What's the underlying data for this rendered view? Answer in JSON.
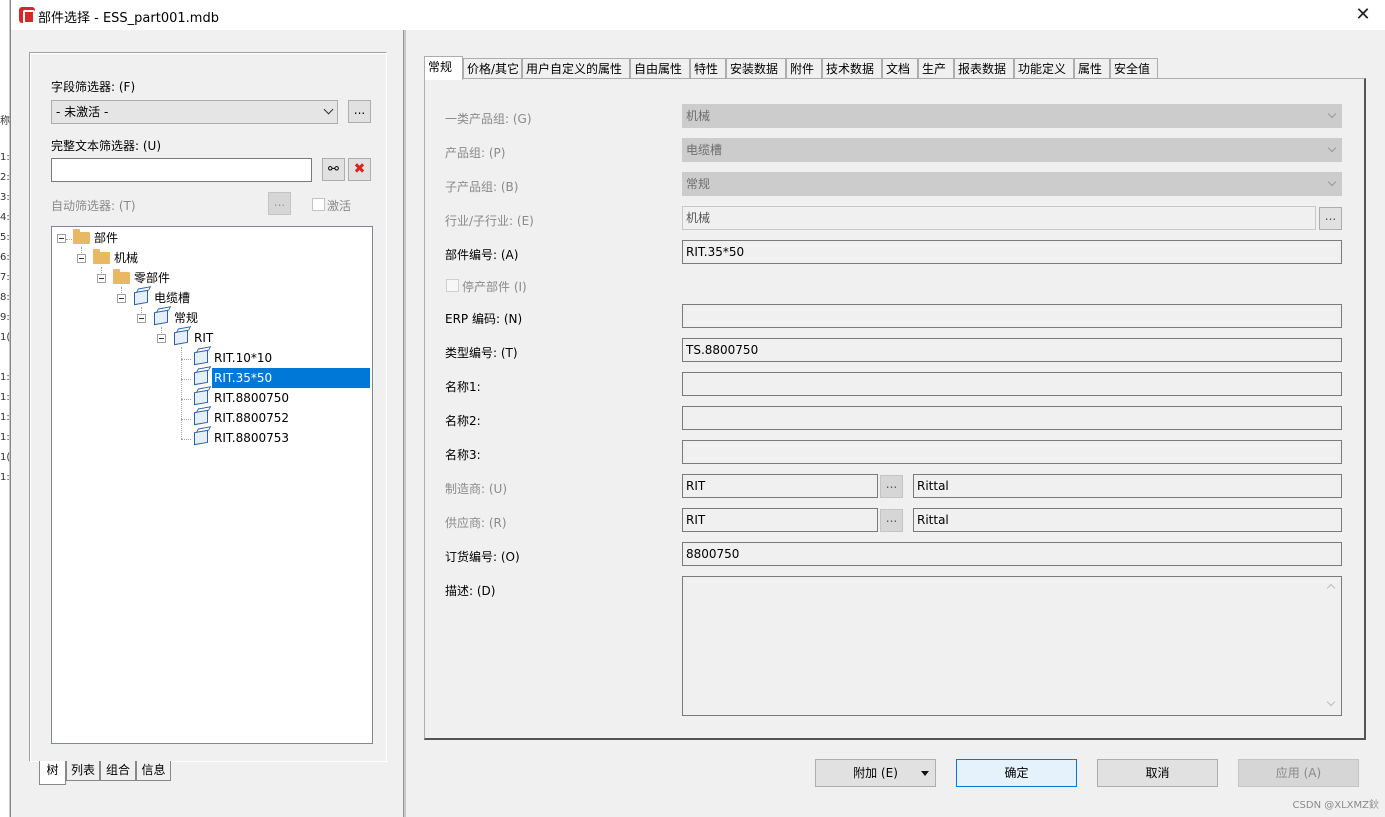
{
  "window": {
    "title": "部件选择 - ESS_part001.mdb"
  },
  "backdrop": {
    "rows": [
      "称",
      "1:",
      "2:",
      "3:",
      "4:",
      "5:",
      "6:",
      "7:",
      "8:",
      "9:",
      "1(",
      "1:",
      "1:",
      "1:",
      "1:",
      "1(",
      "1:"
    ]
  },
  "left": {
    "field_filter_label": "字段筛选器: (F)",
    "field_filter_value": "- 未激活 -",
    "field_filter_more": "...",
    "fulltext_filter_label": "完整文本筛选器: (U)",
    "fulltext_value": "",
    "auto_filter_label": "自动筛选器: (T)",
    "auto_filter_more": "...",
    "activate_label": "激活",
    "tree": [
      {
        "label": "部件"
      },
      {
        "label": "机械"
      },
      {
        "label": "零部件"
      },
      {
        "label": "电缆槽"
      },
      {
        "label": "常规"
      },
      {
        "label": "RIT"
      },
      {
        "label": "RIT.10*10"
      },
      {
        "label": "RIT.35*50"
      },
      {
        "label": "RIT.8800750"
      },
      {
        "label": "RIT.8800752"
      },
      {
        "label": "RIT.8800753"
      }
    ],
    "tabs": [
      "树",
      "列表",
      "组合",
      "信息"
    ]
  },
  "right": {
    "tabs": [
      "常规",
      "价格/其它",
      "用户自定义的属性",
      "自由属性",
      "特性",
      "安装数据",
      "附件",
      "技术数据",
      "文档",
      "生产",
      "报表数据",
      "功能定义",
      "属性",
      "安全值"
    ],
    "fields": {
      "product_group1_label": "一类产品组: (G)",
      "product_group1_value": "机械",
      "product_group_label": "产品组: (P)",
      "product_group_value": "电缆槽",
      "sub_product_group_label": "子产品组: (B)",
      "sub_product_group_value": "常规",
      "industry_label": "行业/子行业: (E)",
      "industry_value": "机械",
      "industry_more": "...",
      "part_number_label": "部件编号: (A)",
      "part_number_value": "RIT.35*50",
      "discontinued_label": "停产部件 (I)",
      "erp_label": "ERP 编码: (N)",
      "erp_value": "",
      "type_number_label": "类型编号: (T)",
      "type_number_value": "TS.8800750",
      "name1_label": "名称1:",
      "name1_value": "",
      "name2_label": "名称2:",
      "name2_value": "",
      "name3_label": "名称3:",
      "name3_value": "",
      "manufacturer_label": "制造商: (U)",
      "manufacturer_code": "RIT",
      "manufacturer_more": "...",
      "manufacturer_name": "Rittal",
      "supplier_label": "供应商: (R)",
      "supplier_code": "RIT",
      "supplier_more": "...",
      "supplier_name": "Rittal",
      "order_number_label": "订货编号: (O)",
      "order_number_value": "8800750",
      "description_label": "描述: (D)",
      "description_value": ""
    }
  },
  "buttons": {
    "extra": "附加 (E)",
    "ok": "确定",
    "cancel": "取消",
    "apply": "应用 (A)"
  },
  "watermark": "CSDN @XLXMZ鈥"
}
